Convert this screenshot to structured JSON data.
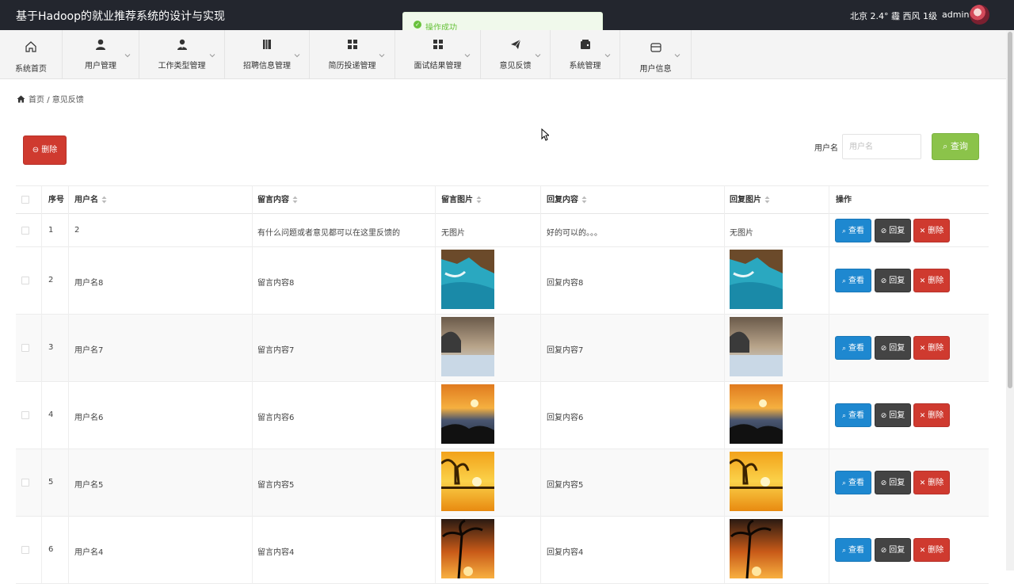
{
  "app": {
    "title": "基于Hadoop的就业推荐系统的设计与实现"
  },
  "header": {
    "weather": "北京  2.4°  霾  西风 1级",
    "username": "admin"
  },
  "toast": {
    "message": "操作成功"
  },
  "nav": {
    "items": [
      {
        "label": "系统首页",
        "icon": "home-icon"
      },
      {
        "label": "用户管理",
        "icon": "user-icon"
      },
      {
        "label": "工作类型管理",
        "icon": "user-tie-icon"
      },
      {
        "label": "招聘信息管理",
        "icon": "book-icon"
      },
      {
        "label": "简历投递管理",
        "icon": "grid-icon"
      },
      {
        "label": "面试结果管理",
        "icon": "grid-icon"
      },
      {
        "label": "意见反馈",
        "icon": "paper-plane-icon"
      },
      {
        "label": "系统管理",
        "icon": "wallet-icon"
      },
      {
        "label": "用户信息",
        "icon": "card-icon"
      }
    ]
  },
  "breadcrumb": {
    "home": "首页",
    "separator": "/",
    "current": "意见反馈"
  },
  "toolbar": {
    "delete_label": "删除",
    "search_label": "用户名",
    "search_placeholder": "用户名",
    "search_value": "",
    "search_button": "查询"
  },
  "table": {
    "columns": [
      "序号",
      "用户名",
      "留言内容",
      "留言图片",
      "回复内容",
      "回复图片",
      "操作"
    ],
    "rows": [
      {
        "no": "1",
        "user": "2",
        "content": "有什么问题或者意见都可以在这里反馈的",
        "image": "无图片",
        "reply": "好的可以的。。。",
        "reply_image": "无图片"
      },
      {
        "no": "2",
        "user": "用户名8",
        "content": "留言内容8",
        "image_kind": "sea-cliff",
        "reply": "回复内容8",
        "reply_image_kind": "sea-cliff"
      },
      {
        "no": "3",
        "user": "用户名7",
        "content": "留言内容7",
        "image_kind": "misty-lake",
        "reply": "回复内容7",
        "reply_image_kind": "misty-lake"
      },
      {
        "no": "4",
        "user": "用户名6",
        "content": "留言内容6",
        "image_kind": "sunset-rocks",
        "reply": "回复内容6",
        "reply_image_kind": "sunset-rocks"
      },
      {
        "no": "5",
        "user": "用户名5",
        "content": "留言内容5",
        "image_kind": "golden-sunset",
        "reply": "回复内容5",
        "reply_image_kind": "golden-sunset"
      },
      {
        "no": "6",
        "user": "用户名4",
        "content": "留言内容4",
        "image_kind": "palm-sunset",
        "reply": "回复内容4",
        "reply_image_kind": "palm-sunset"
      }
    ],
    "actions": {
      "view": "查看",
      "reply": "回复",
      "delete": "删除"
    }
  },
  "colors": {
    "topbar": "#23262e",
    "danger": "#cf3a2f",
    "primary": "#1e88d0",
    "dark": "#444444",
    "success": "#8bc34a",
    "toast_bg": "#f0f9eb",
    "toast_text": "#67c23a"
  }
}
